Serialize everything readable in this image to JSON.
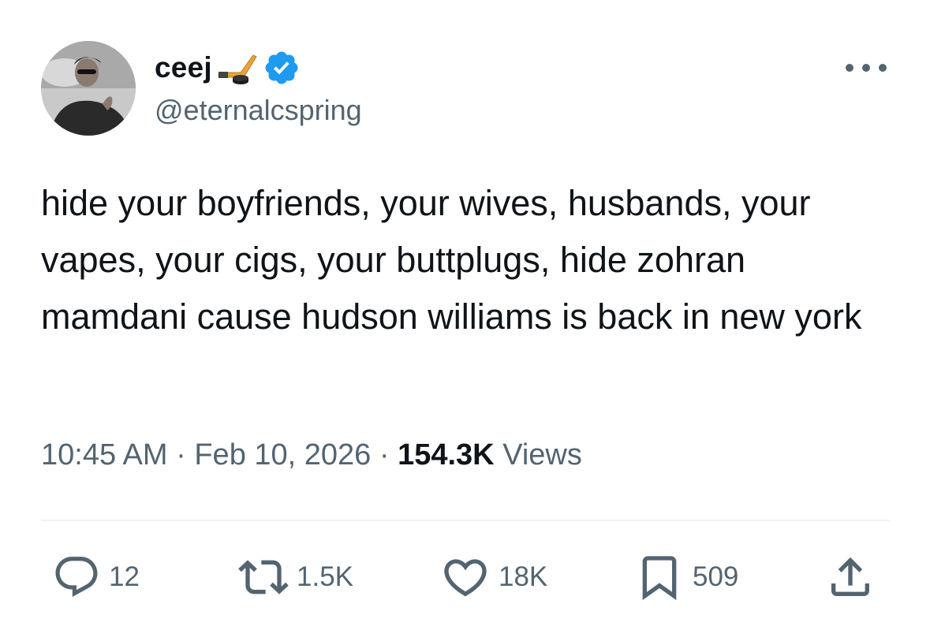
{
  "tweet": {
    "author": {
      "display_name": "ceej",
      "handle": "@eternalcspring",
      "verified": true,
      "name_emoji_icon": "hockey-stick-puck-icon"
    },
    "text": "hide your boyfriends, your wives, husbands, your vapes, your cigs, your buttplugs, hide zohran mamdani cause hudson williams is back in new york",
    "time": "10:45 AM",
    "separator": "·",
    "date": "Feb 10, 2026",
    "views_count": "154.3K",
    "views_label": "Views",
    "actions": {
      "replies": "12",
      "reposts": "1.5K",
      "likes": "18K",
      "bookmarks": "509"
    }
  },
  "colors": {
    "text_primary": "#0f1419",
    "text_secondary": "#536471",
    "verified_blue": "#1d9bf0",
    "divider": "#eff3f4"
  }
}
